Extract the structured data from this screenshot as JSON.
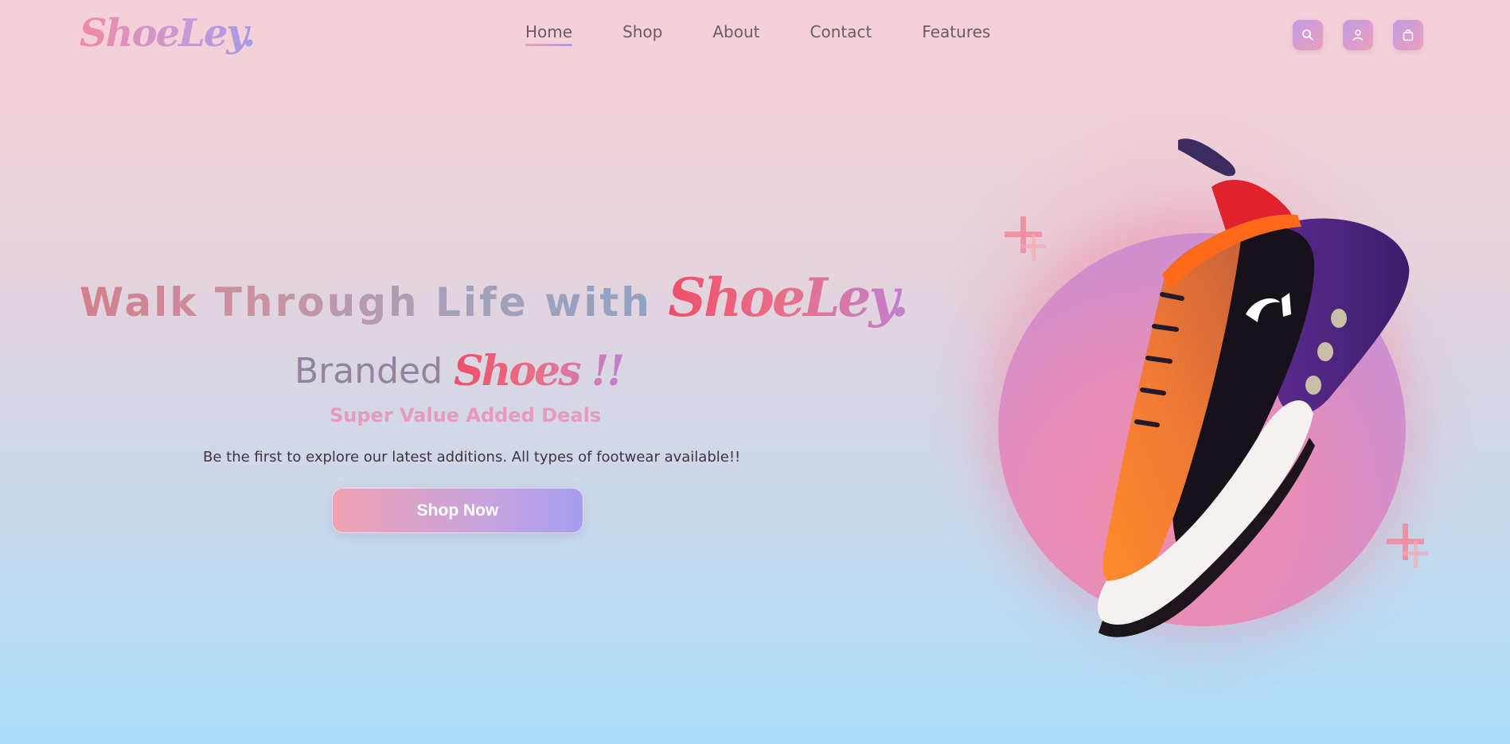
{
  "brand": {
    "logo_text": "ShoeLey."
  },
  "nav": {
    "items": [
      "Home",
      "Shop",
      "About",
      "Contact",
      "Features"
    ],
    "active": "Home"
  },
  "header_icons": [
    "search-icon",
    "user-icon",
    "shopping-bag-icon"
  ],
  "hero": {
    "title_plain": "Walk Through Life with ",
    "title_brand": "ShoeLey.",
    "subtitle_plain": "Branded",
    "subtitle_script": "Shoes !!",
    "tagline": "Super Value Added Deals",
    "description": "Be the first to explore our latest additions. All types of footwear available!!",
    "cta_label": "Shop Now"
  },
  "colors": {
    "accent_pink": "#ee4f6a",
    "accent_purple": "#a69ae6",
    "tagline": "#e69bbd",
    "background_top": "#f5d0d8",
    "background_bottom": "#addcf7"
  }
}
